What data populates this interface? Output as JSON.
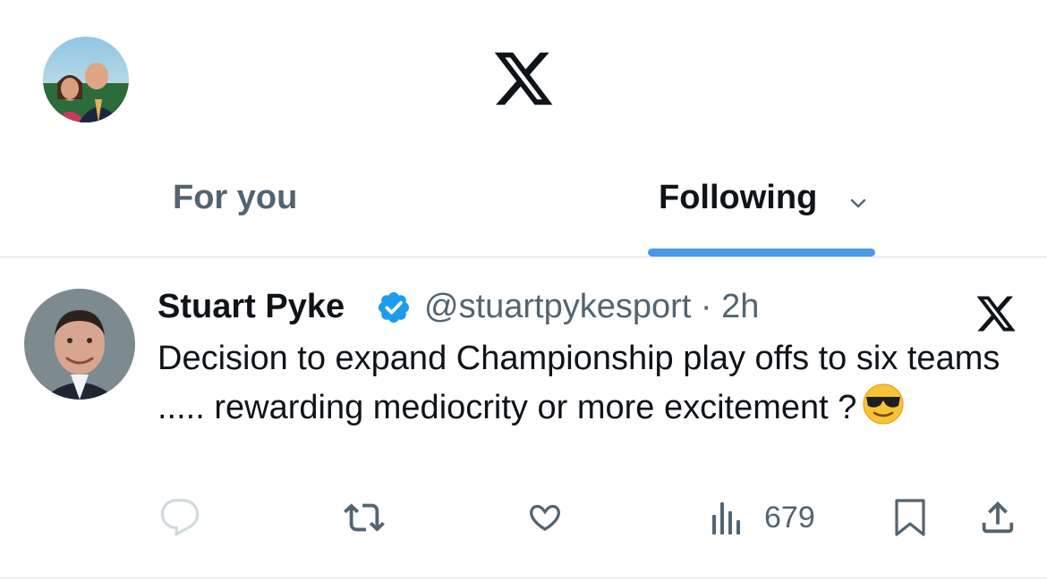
{
  "header": {
    "logo": "x-logo-icon"
  },
  "tabs": [
    {
      "label": "For you",
      "selected": false
    },
    {
      "label": "Following",
      "selected": true
    }
  ],
  "post": {
    "author_name": "Stuart Pyke",
    "verified": true,
    "handle_line": "@stuartpykesport · 2h",
    "text": "Decision to expand Championship play offs to six teams ..... rewarding mediocrity or more excitement ?",
    "emoji": "smiling-face-with-sunglasses",
    "views": "679"
  },
  "colors": {
    "accent": "#4a99e9",
    "secondary_text": "#536471",
    "primary_text": "#0f1419"
  }
}
